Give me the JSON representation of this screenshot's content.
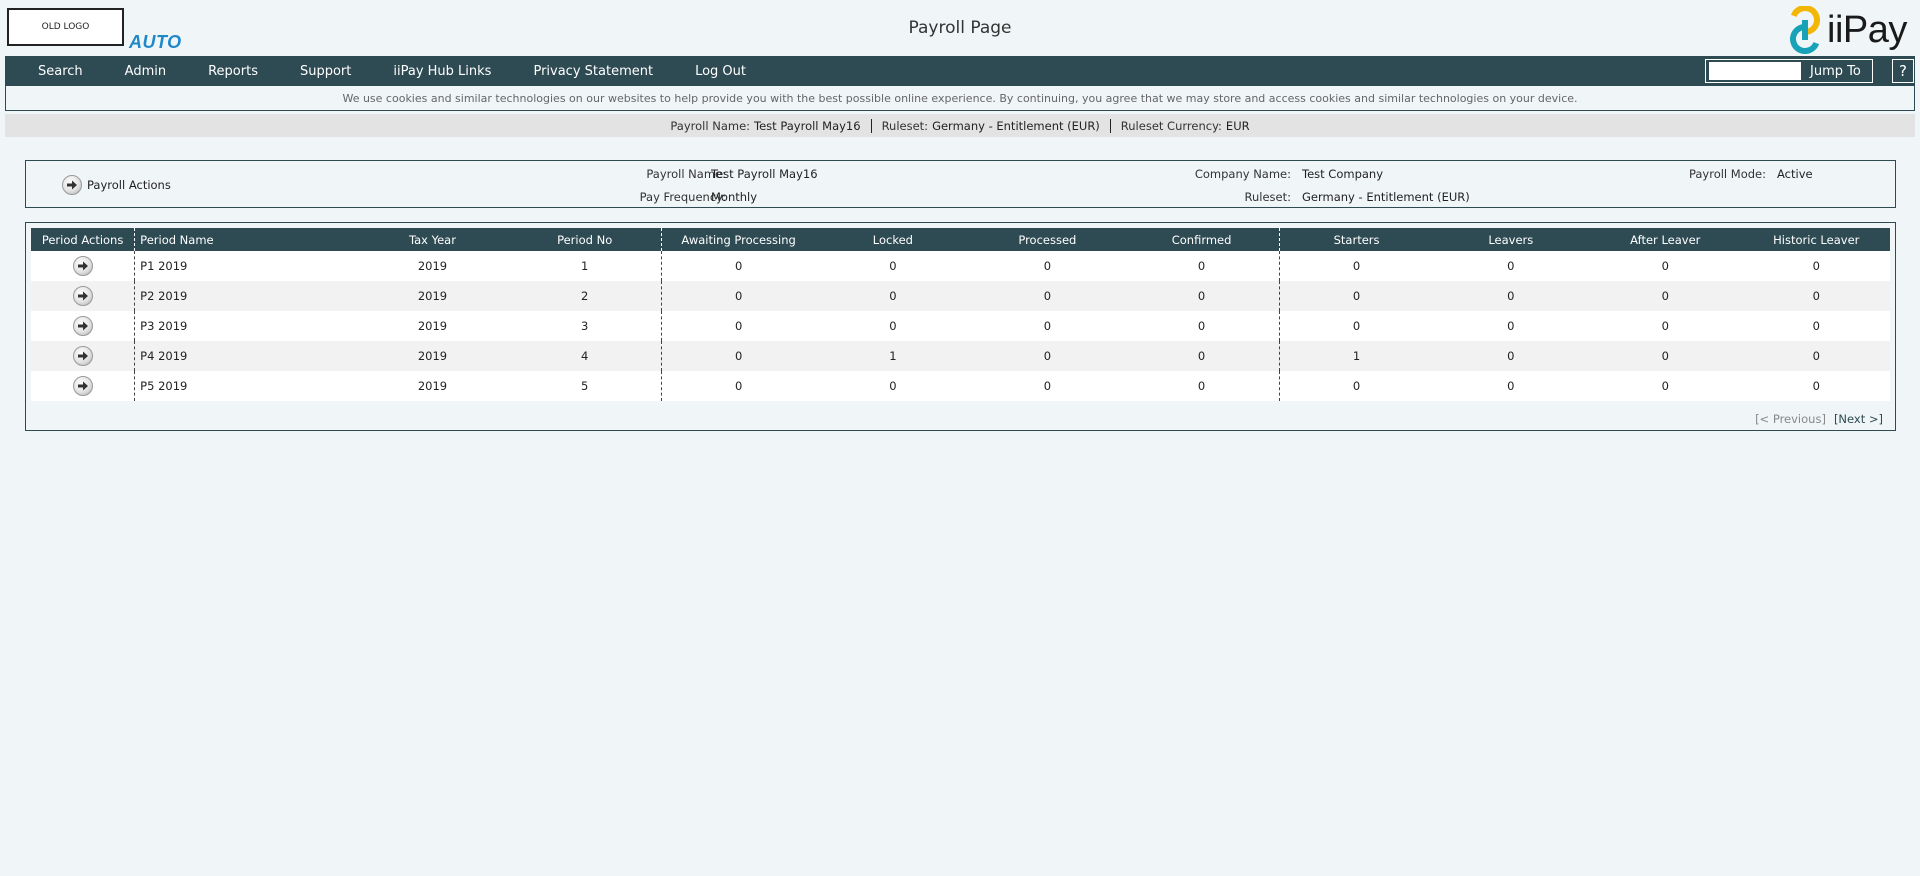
{
  "header": {
    "logo_text": "OLD LOGO",
    "auto_label": "AUTO",
    "page_title": "Payroll Page",
    "brand_name": "iiPay",
    "brand_colors": {
      "yellow": "#f2b705",
      "teal": "#17a2b8"
    }
  },
  "nav": {
    "items": [
      {
        "label": "Search"
      },
      {
        "label": "Admin"
      },
      {
        "label": "Reports"
      },
      {
        "label": "Support"
      },
      {
        "label": "iiPay Hub Links"
      },
      {
        "label": "Privacy Statement"
      },
      {
        "label": "Log Out"
      }
    ],
    "jump_to_value": "",
    "jump_to_label": "Jump To",
    "help_label": "?"
  },
  "cookie_notice": "We use cookies and similar technologies on our websites to help provide you with the best possible online experience. By continuing, you agree that we may store and access cookies and similar technologies on your device.",
  "info_bar": {
    "payroll_name_label": "Payroll Name:",
    "payroll_name": "Test Payroll May16",
    "ruleset_label": "Ruleset:",
    "ruleset": "Germany - Entitlement (EUR)",
    "currency_label": "Ruleset Currency:",
    "currency": "EUR"
  },
  "details": {
    "actions_label": "Payroll Actions",
    "payroll_name_label": "Payroll Name:",
    "payroll_name": "Test Payroll May16",
    "pay_frequency_label": "Pay Frequency:",
    "pay_frequency": "Monthly",
    "company_name_label": "Company Name:",
    "company_name": "Test Company",
    "ruleset_label": "Ruleset:",
    "ruleset": "Germany - Entitlement (EUR)",
    "payroll_mode_label": "Payroll Mode:",
    "payroll_mode": "Active"
  },
  "grid": {
    "columns": [
      "Period Actions",
      "Period Name",
      "Tax Year",
      "Period No",
      "Awaiting Processing",
      "Locked",
      "Processed",
      "Confirmed",
      "Starters",
      "Leavers",
      "After Leaver",
      "Historic Leaver"
    ],
    "rows": [
      {
        "period_name": "P1 2019",
        "tax_year": "2019",
        "period_no": "1",
        "awaiting": "0",
        "locked": "0",
        "processed": "0",
        "confirmed": "0",
        "starters": "0",
        "leavers": "0",
        "after_leaver": "0",
        "historic_leaver": "0"
      },
      {
        "period_name": "P2 2019",
        "tax_year": "2019",
        "period_no": "2",
        "awaiting": "0",
        "locked": "0",
        "processed": "0",
        "confirmed": "0",
        "starters": "0",
        "leavers": "0",
        "after_leaver": "0",
        "historic_leaver": "0"
      },
      {
        "period_name": "P3 2019",
        "tax_year": "2019",
        "period_no": "3",
        "awaiting": "0",
        "locked": "0",
        "processed": "0",
        "confirmed": "0",
        "starters": "0",
        "leavers": "0",
        "after_leaver": "0",
        "historic_leaver": "0"
      },
      {
        "period_name": "P4 2019",
        "tax_year": "2019",
        "period_no": "4",
        "awaiting": "0",
        "locked": "1",
        "processed": "0",
        "confirmed": "0",
        "starters": "1",
        "leavers": "0",
        "after_leaver": "0",
        "historic_leaver": "0"
      },
      {
        "period_name": "P5 2019",
        "tax_year": "2019",
        "period_no": "5",
        "awaiting": "0",
        "locked": "0",
        "processed": "0",
        "confirmed": "0",
        "starters": "0",
        "leavers": "0",
        "after_leaver": "0",
        "historic_leaver": "0"
      }
    ],
    "pager": {
      "previous": "[< Previous]",
      "next": "[Next >]"
    }
  }
}
